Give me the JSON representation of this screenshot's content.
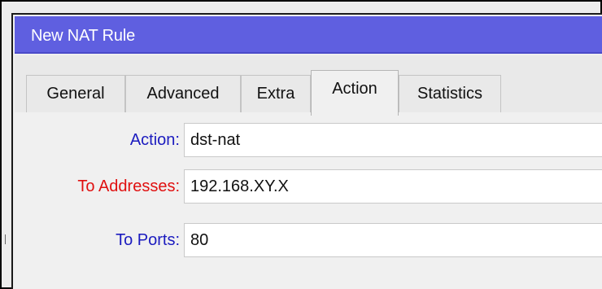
{
  "window": {
    "title": "New NAT Rule"
  },
  "tabs": [
    {
      "label": "General"
    },
    {
      "label": "Advanced"
    },
    {
      "label": "Extra"
    },
    {
      "label": "Action"
    },
    {
      "label": "Statistics"
    }
  ],
  "active_tab": "Action",
  "form": {
    "action": {
      "label": "Action:",
      "value": "dst-nat"
    },
    "to_addresses": {
      "label": "To Addresses:",
      "value": "192.168.XY.X"
    },
    "to_ports": {
      "label": "To Ports:",
      "value": "80"
    }
  },
  "colors": {
    "titlebar": "#5f5fe0",
    "label_blue": "#1b1bbf",
    "label_red": "#e01010"
  }
}
